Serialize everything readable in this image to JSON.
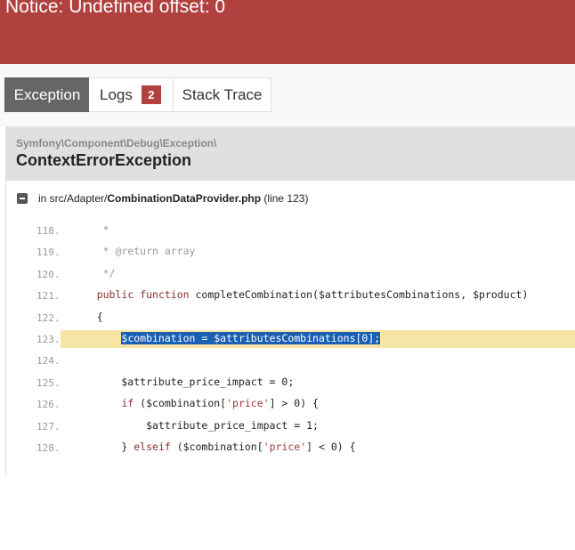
{
  "header": {
    "title": "Notice: Undefined offset: 0"
  },
  "tabs": {
    "exception": "Exception",
    "logs": "Logs",
    "logs_count": "2",
    "stack_trace": "Stack Trace"
  },
  "exception": {
    "namespace": "Symfony\\Component\\Debug\\Exception\\",
    "class": "ContextErrorException"
  },
  "file": {
    "prefix": "in src/Adapter/",
    "name": "CombinationDataProvider.php",
    "line_info": "(line 123)"
  },
  "code": {
    "highlighted_line": "123",
    "lines": [
      {
        "n": "118.",
        "text": "     *"
      },
      {
        "n": "119.",
        "text": "     * @return array"
      },
      {
        "n": "120.",
        "text": "     */"
      },
      {
        "n": "121.",
        "text": "    public function completeCombination($attributesCombinations, $product)"
      },
      {
        "n": "122.",
        "text": "    {"
      },
      {
        "n": "123.",
        "text": "        $combination = $attributesCombinations[0];"
      },
      {
        "n": "124.",
        "text": ""
      },
      {
        "n": "125.",
        "text": "        $attribute_price_impact = 0;"
      },
      {
        "n": "126.",
        "text": "        if ($combination['price'] > 0) {"
      },
      {
        "n": "127.",
        "text": "            $attribute_price_impact = 1;"
      },
      {
        "n": "128.",
        "text": "        } elseif ($combination['price'] < 0) {"
      }
    ]
  },
  "colors": {
    "header_bg": "#b0413e",
    "active_tab": "#666666",
    "badge": "#b0413e",
    "highlight": "#f7e5a6",
    "selection": "#1a5fb4"
  },
  "icons": {
    "collapse": "minus-square-icon"
  }
}
